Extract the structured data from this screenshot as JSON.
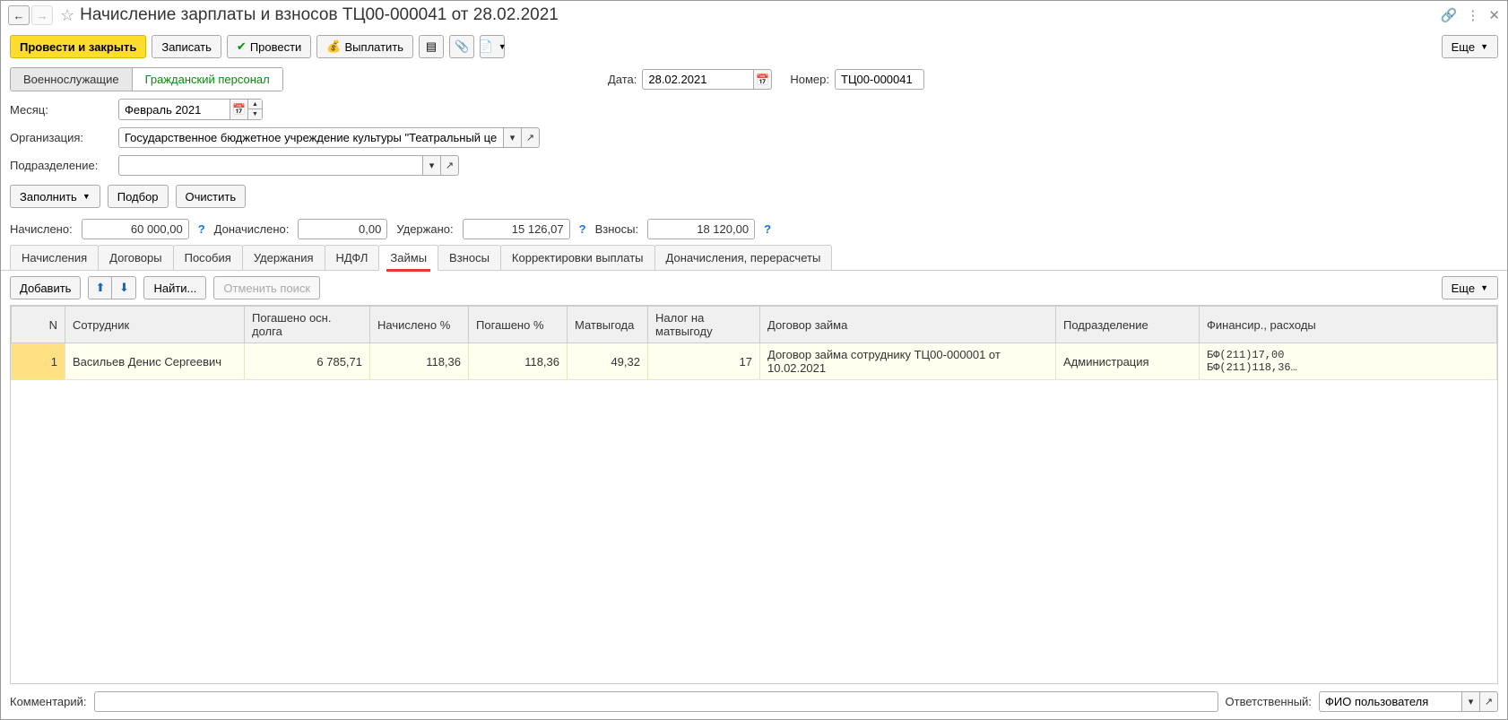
{
  "title": "Начисление зарплаты и взносов ТЦ00-000041 от 28.02.2021",
  "toolbar": {
    "post_and_close": "Провести и закрыть",
    "save": "Записать",
    "post": "Провести",
    "pay": "Выплатить",
    "more": "Еще"
  },
  "segments": {
    "military": "Военнослужащие",
    "civil": "Гражданский персонал"
  },
  "header": {
    "date_label": "Дата:",
    "date_value": "28.02.2021",
    "number_label": "Номер:",
    "number_value": "ТЦ00-000041"
  },
  "form": {
    "month_label": "Месяц:",
    "month_value": "Февраль 2021",
    "org_label": "Организация:",
    "org_value": "Государственное бюджетное учреждение культуры \"Театральный центр\"",
    "dept_label": "Подразделение:",
    "dept_value": ""
  },
  "actions": {
    "fill": "Заполнить",
    "pick": "Подбор",
    "clear": "Очистить"
  },
  "totals": {
    "accrued_label": "Начислено:",
    "accrued_value": "60 000,00",
    "extra_label": "Доначислено:",
    "extra_value": "0,00",
    "withheld_label": "Удержано:",
    "withheld_value": "15 126,07",
    "contrib_label": "Взносы:",
    "contrib_value": "18 120,00"
  },
  "tabs": {
    "accruals": "Начисления",
    "contracts": "Договоры",
    "benefits": "Пособия",
    "deductions": "Удержания",
    "ndfl": "НДФЛ",
    "loans": "Займы",
    "contributions": "Взносы",
    "corrections": "Корректировки выплаты",
    "recalcs": "Доначисления, перерасчеты"
  },
  "table_toolbar": {
    "add": "Добавить",
    "find": "Найти...",
    "cancel_search": "Отменить поиск",
    "more": "Еще"
  },
  "columns": {
    "n": "N",
    "employee": "Сотрудник",
    "principal_paid": "Погашено осн. долга",
    "interest_accrued": "Начислено %",
    "interest_paid": "Погашено %",
    "matbenefit": "Матвыгода",
    "tax_matbenefit": "Налог на матвыгоду",
    "loan_contract": "Договор займа",
    "department": "Подразделение",
    "financing": "Финансир., расходы"
  },
  "rows": [
    {
      "n": "1",
      "employee": "Васильев Денис Сергеевич",
      "principal_paid": "6 785,71",
      "interest_accrued": "118,36",
      "interest_paid": "118,36",
      "matbenefit": "49,32",
      "tax_matbenefit": "17",
      "loan_contract": "Договор займа сотруднику ТЦ00-000001 от 10.02.2021",
      "department": "Администрация",
      "financing1": "БФ(211)17,00",
      "financing2": "БФ(211)118,36…"
    }
  ],
  "footer": {
    "comment_label": "Комментарий:",
    "comment_value": "",
    "responsible_label": "Ответственный:",
    "responsible_value": "ФИО пользователя"
  }
}
